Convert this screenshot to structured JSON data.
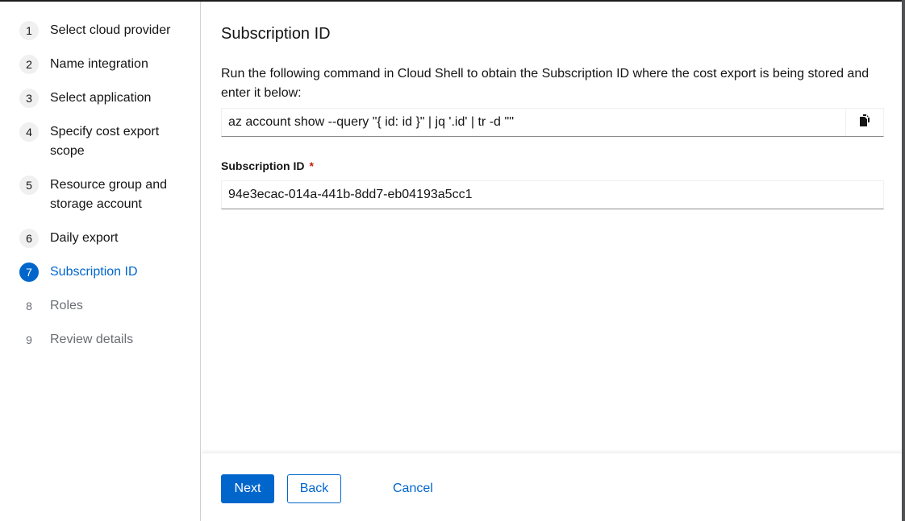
{
  "wizard": {
    "steps": [
      {
        "number": "1",
        "label": "Select cloud provider",
        "state": "visited"
      },
      {
        "number": "2",
        "label": "Name integration",
        "state": "visited"
      },
      {
        "number": "3",
        "label": "Select application",
        "state": "visited"
      },
      {
        "number": "4",
        "label": "Specify cost export scope",
        "state": "visited"
      },
      {
        "number": "5",
        "label": "Resource group and storage account",
        "state": "visited"
      },
      {
        "number": "6",
        "label": "Daily export",
        "state": "visited"
      },
      {
        "number": "7",
        "label": "Subscription ID",
        "state": "current"
      },
      {
        "number": "8",
        "label": "Roles",
        "state": "disabled"
      },
      {
        "number": "9",
        "label": "Review details",
        "state": "disabled"
      }
    ]
  },
  "main": {
    "title": "Subscription ID",
    "description": "Run the following command in Cloud Shell to obtain the Subscription ID where the cost export is being stored and enter it below:",
    "command": "az account show --query \"{ id: id }\" | jq '.id' | tr -d '\"'",
    "copy_icon": "copy-icon",
    "field_label": "Subscription ID",
    "required_marker": "*",
    "subscription_id_value": "94e3ecac-014a-441b-8dd7-eb04193a5cc1"
  },
  "footer": {
    "next_label": "Next",
    "back_label": "Back",
    "cancel_label": "Cancel"
  },
  "colors": {
    "accent": "#0066cc",
    "required": "#c9190b",
    "disabled_text": "#6a6e73"
  }
}
